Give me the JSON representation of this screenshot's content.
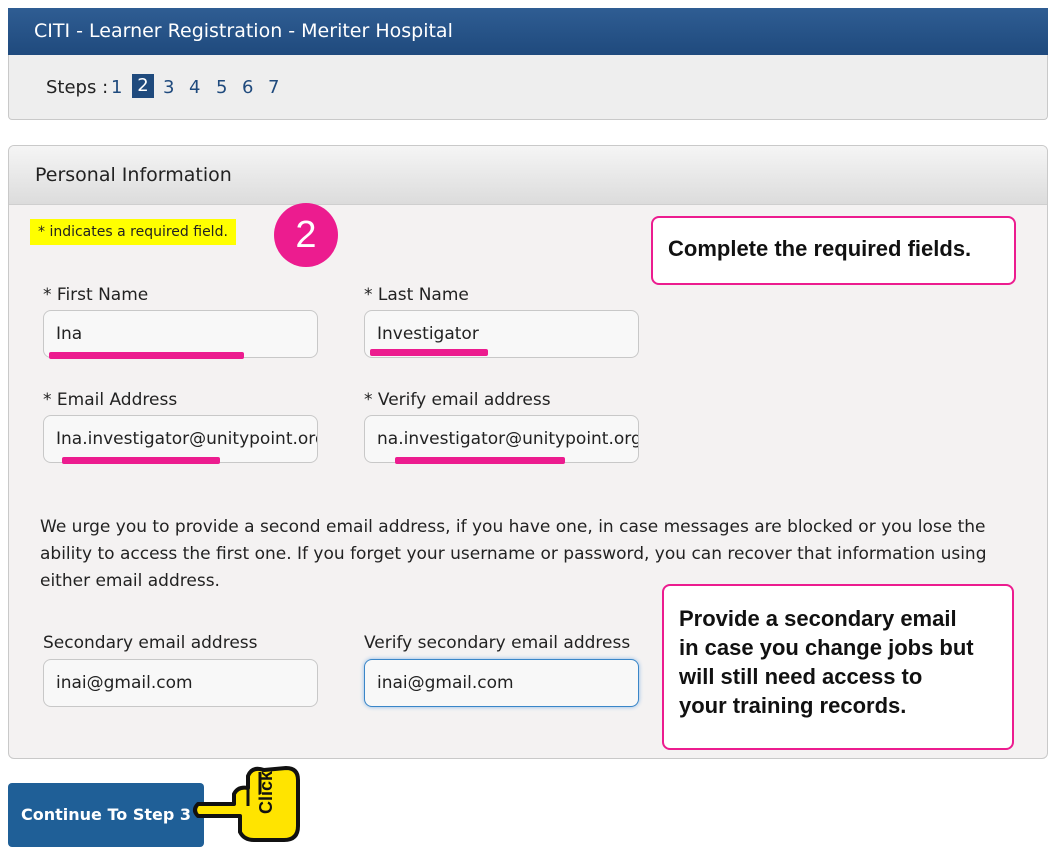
{
  "window": {
    "title": "CITI - Learner Registration - Meriter Hospital"
  },
  "steps": {
    "label": "Steps :",
    "items": [
      "1",
      "2",
      "3",
      "4",
      "5",
      "6",
      "7"
    ],
    "current": "2"
  },
  "panel": {
    "title": "Personal Information",
    "required_note": "* indicates a required field.",
    "step_badge": "2"
  },
  "callouts": {
    "required": "Complete the required fields.",
    "secondary": [
      "Provide a secondary email",
      "in case you change jobs but",
      "will still need access to",
      "your training records."
    ]
  },
  "fields": {
    "first_name": {
      "label": "* First Name",
      "value": "Ina"
    },
    "last_name": {
      "label": "* Last Name",
      "value": "Investigator"
    },
    "email": {
      "label": "* Email Address",
      "value": "Ina.investigator@unitypoint.org"
    },
    "verify_email": {
      "label": "* Verify email address",
      "value": "na.investigator@unitypoint.org"
    },
    "secondary_email": {
      "label": "Secondary email address",
      "value": "inai@gmail.com"
    },
    "verify_secondary_email": {
      "label": "Verify secondary email address",
      "value": "inai@gmail.com"
    }
  },
  "paragraph": "We urge you to provide a second email address, if you have one, in case messages are blocked or you lose the ability to access the first one. If you forget your username or password, you can recover that information using either email address.",
  "continue_button": {
    "label": "Continue To Step 3"
  },
  "hand_icon": {
    "label": "Click"
  },
  "colors": {
    "header": "#1f4a7d",
    "accent": "#ec1c8f",
    "highlight": "#ffff00",
    "button": "#1f5f97"
  }
}
